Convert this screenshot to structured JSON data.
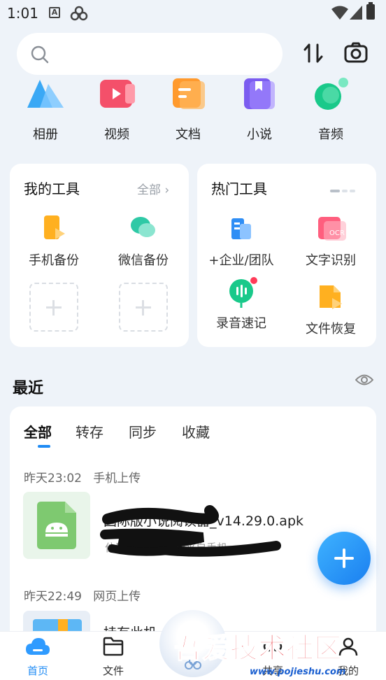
{
  "status_bar": {
    "time": "1:01",
    "icon_a_text": "A"
  },
  "search": {
    "placeholder": ""
  },
  "categories": [
    {
      "label": "相册",
      "icon": "album-icon"
    },
    {
      "label": "视频",
      "icon": "video-icon"
    },
    {
      "label": "文档",
      "icon": "document-icon"
    },
    {
      "label": "小说",
      "icon": "novel-icon"
    },
    {
      "label": "音频",
      "icon": "audio-icon"
    }
  ],
  "my_tools": {
    "title": "我的工具",
    "all_link": "全部",
    "items": [
      {
        "label": "手机备份",
        "icon": "phone-backup-icon"
      },
      {
        "label": "微信备份",
        "icon": "wechat-backup-icon"
      }
    ]
  },
  "hot_tools": {
    "title": "热门工具",
    "items": [
      {
        "label": "+企业/团队",
        "icon": "enterprise-team-icon"
      },
      {
        "label": "文字识别",
        "icon": "ocr-icon"
      },
      {
        "label": "录音速记",
        "icon": "voice-note-icon"
      },
      {
        "label": "文件恢复",
        "icon": "file-recovery-icon"
      }
    ],
    "ocr_badge": "OCR"
  },
  "recent": {
    "title": "最近",
    "tabs": [
      "全部",
      "转存",
      "同步",
      "收藏"
    ],
    "active_tab": 0,
    "groups": [
      {
        "time": "昨天23:02",
        "source": "手机上传",
        "file_name": "国际版小说阅读器_v14.29.0.apk",
        "file_sub": "位置：/我的资源/来自手机"
      },
      {
        "time": "昨天22:49",
        "source": "网页上传",
        "file_name": "持有此机"
      }
    ]
  },
  "bottom_nav": [
    {
      "label": "首页",
      "icon": "home-cloud-icon",
      "active": true
    },
    {
      "label": "文件",
      "icon": "folder-icon",
      "active": false
    },
    {
      "label": "",
      "icon": "center-cloud-icon",
      "active": false
    },
    {
      "label": "共享",
      "icon": "share-icon",
      "active": false
    },
    {
      "label": "我的",
      "icon": "profile-icon",
      "active": false
    }
  ],
  "watermark": {
    "text": "吾爱技术社区",
    "url": "www.pojieshu.com"
  },
  "colors": {
    "accent": "#1f8bf4",
    "background": "#eef3f9"
  }
}
